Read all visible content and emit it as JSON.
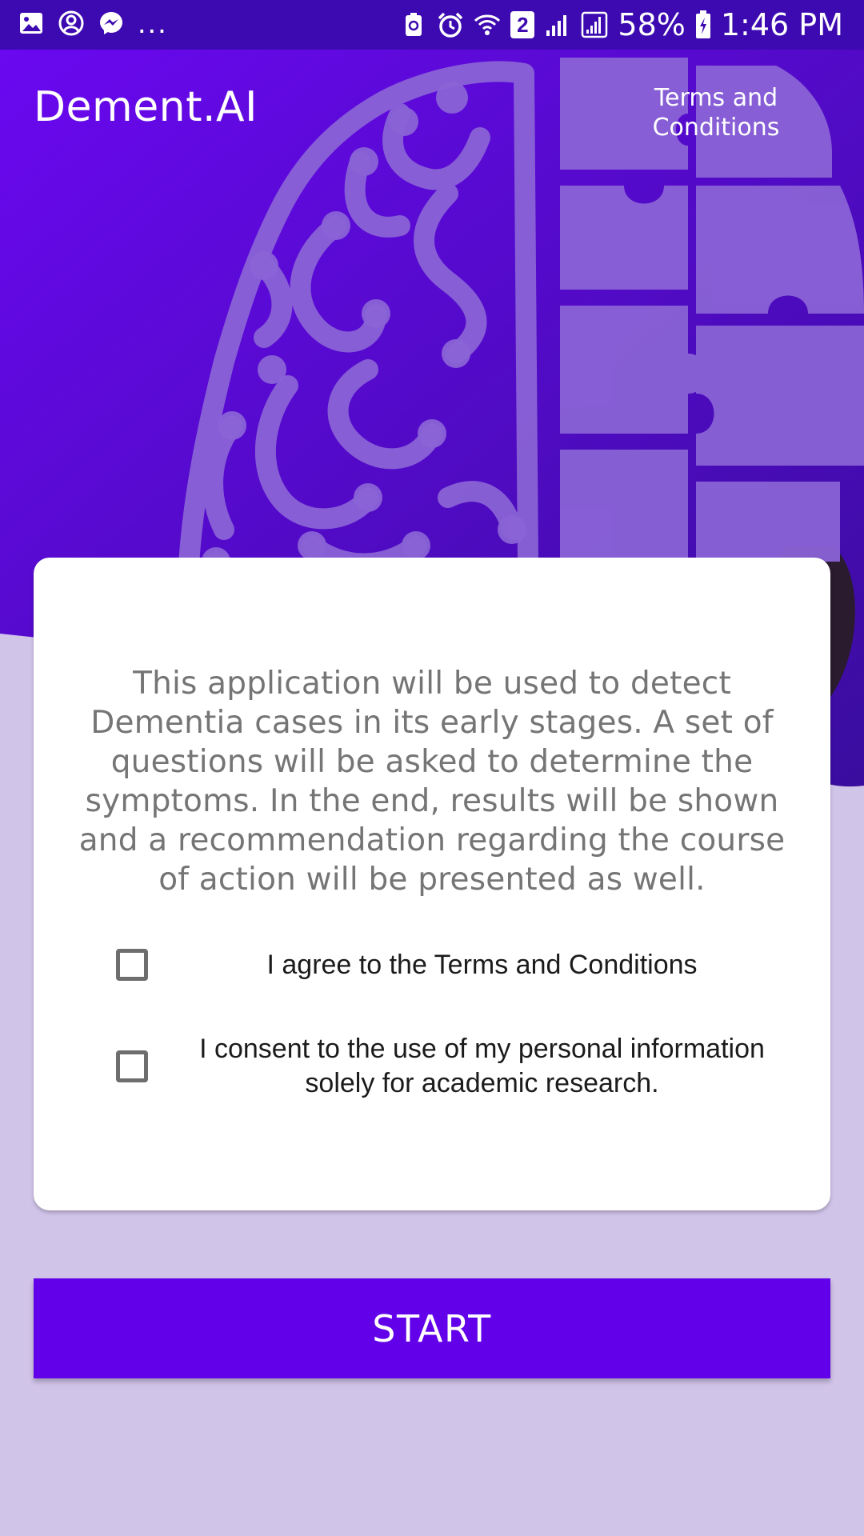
{
  "status_bar": {
    "left_icons": [
      "gallery-icon",
      "account-circle-icon",
      "messenger-icon"
    ],
    "more": "...",
    "right_icons": [
      "nfc-icon",
      "alarm-icon",
      "wifi-icon",
      "sim-2-icon",
      "signal-icon",
      "signal-icon",
      "battery-charging-icon"
    ],
    "sim_label": "2",
    "battery": "58%",
    "time": "1:46 PM"
  },
  "header": {
    "app_title": "Dement.AI",
    "terms_link": "Terms and Conditions"
  },
  "card": {
    "description": "This application will be used to detect Dementia cases in its early stages. A set of questions will be asked to determine the symptoms. In the end, results will be shown and a recommendation regarding the course of action will be presented as well.",
    "checkboxes": [
      {
        "label": "I agree to the Terms and Conditions",
        "checked": false
      },
      {
        "label": "I consent to the use of my personal information solely for academic research.",
        "checked": false
      }
    ]
  },
  "start_button": {
    "label": "START"
  },
  "colors": {
    "status_bar": "#3c0ab0",
    "hero_gradient_start": "#6a08f0",
    "hero_gradient_end": "#3a0d9e",
    "page_background": "#d1c4e9",
    "primary_button": "#6200ea",
    "card_background": "#ffffff",
    "description_text": "#757575"
  }
}
